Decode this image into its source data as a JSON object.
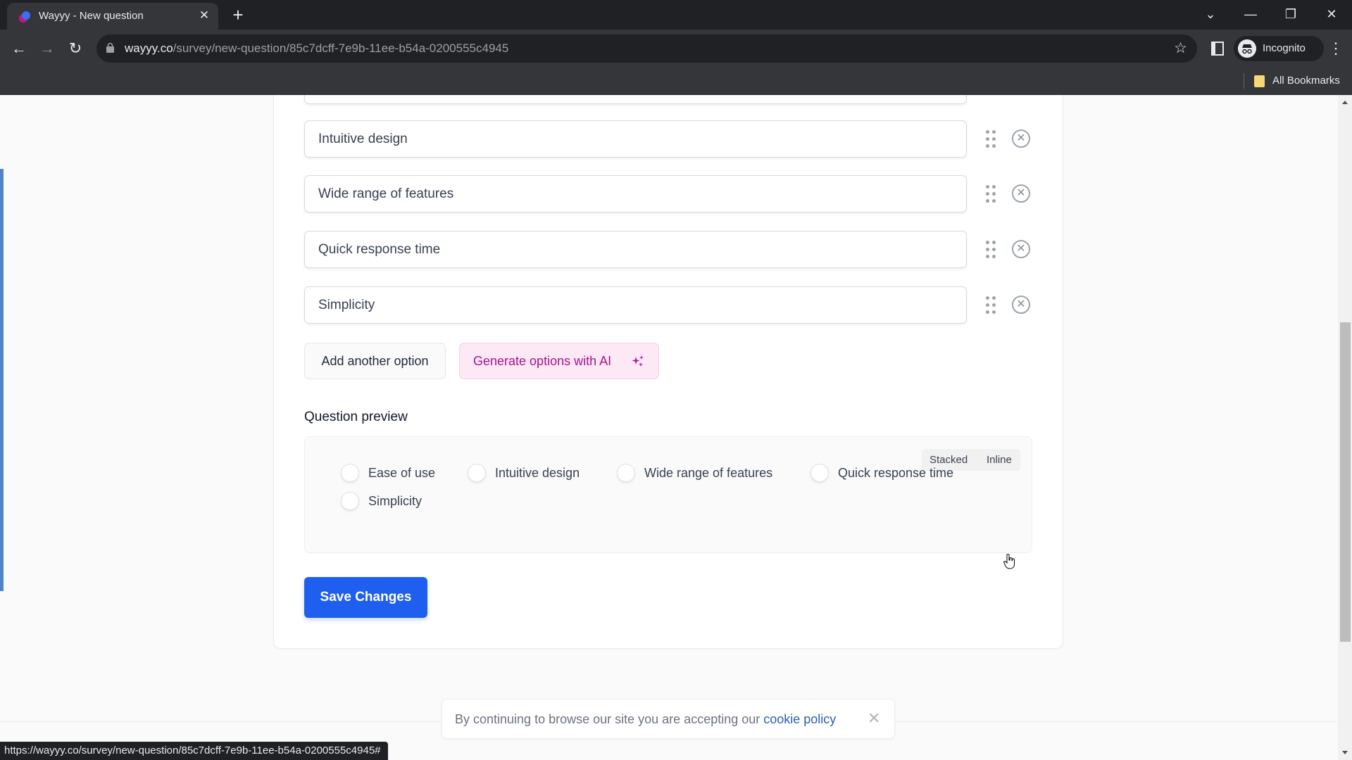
{
  "browser": {
    "tab_title": "Wayyy - New question",
    "url_host": "wayyy.co",
    "url_path": "/survey/new-question/85c7dcff-7e9b-11ee-b54a-0200555c4945",
    "profile_label": "Incognito",
    "bookmarks_label": "All Bookmarks",
    "status_url": "https://wayyy.co/survey/new-question/85c7dcff-7e9b-11ee-b54a-0200555c4945#",
    "icons": {
      "back": "←",
      "forward": "→",
      "reload": "↻",
      "star": "☆",
      "close_tab": "✕",
      "new_tab": "+",
      "tab_search": "⌄",
      "minimize": "—",
      "restore": "❐",
      "close_window": "✕",
      "menu": "⋮"
    }
  },
  "editor": {
    "options": [
      {
        "value": "Intuitive design"
      },
      {
        "value": "Wide range of features"
      },
      {
        "value": "Quick response time"
      },
      {
        "value": "Simplicity"
      }
    ],
    "remove_icon": "✕",
    "add_option_label": "Add another option",
    "generate_ai_label": "Generate options with AI",
    "accent_ai": "#a3158a",
    "primary": "#1f5fef"
  },
  "preview": {
    "title": "Question preview",
    "layout_options": [
      "Stacked",
      "Inline"
    ],
    "selected_layout": "Inline",
    "choices": [
      "Ease of use",
      "Intuitive design",
      "Wide range of features",
      "Quick response time",
      "Simplicity"
    ]
  },
  "actions": {
    "save_label": "Save Changes"
  },
  "cookie_banner": {
    "text": "By continuing to browse our site you are accepting our ",
    "link_text": "cookie policy",
    "close_icon": "✕"
  }
}
